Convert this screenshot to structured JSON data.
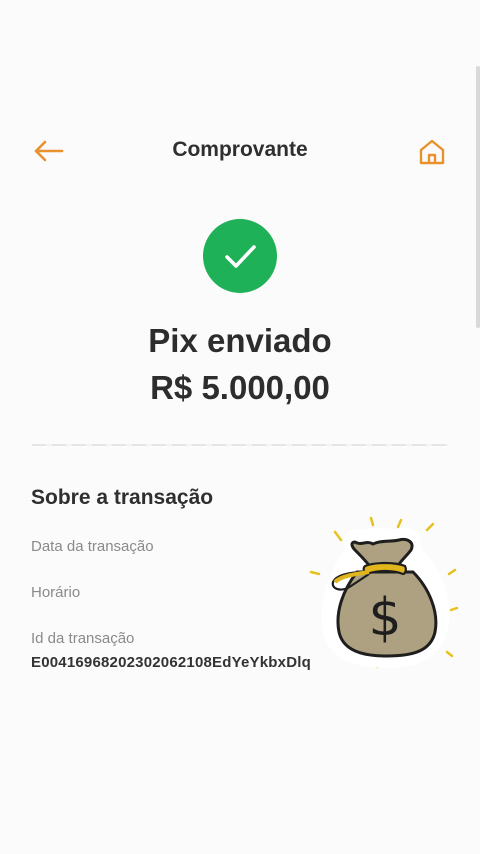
{
  "header": {
    "title": "Comprovante",
    "back_icon": "arrow-left-icon",
    "home_icon": "home-icon"
  },
  "status": {
    "icon": "check-icon",
    "title": "Pix enviado",
    "amount": "R$ 5.000,00"
  },
  "transaction": {
    "section_title": "Sobre a transação",
    "date_label": "Data da transação",
    "time_label": "Horário",
    "id_label": "Id da transação",
    "id_value": "E00416968202302062108EdYeYkbxDlq"
  },
  "sticker": {
    "icon": "money-bag-icon"
  },
  "colors": {
    "accent": "#e8912d",
    "success": "#1fb157",
    "text": "#2d2d2d",
    "muted": "#8a8a8a"
  }
}
